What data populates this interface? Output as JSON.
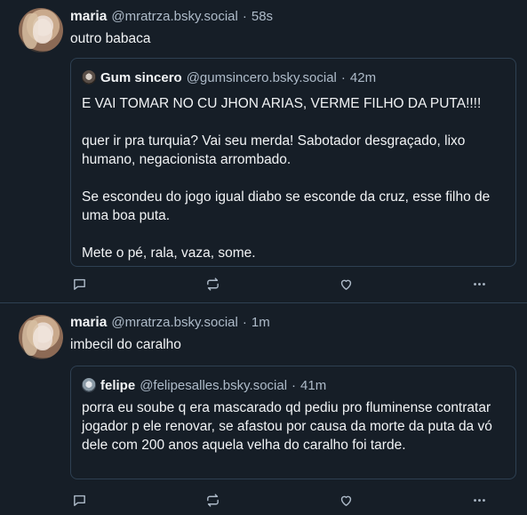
{
  "posts": [
    {
      "author_name": "maria",
      "author_handle": "@mratrza.bsky.social",
      "separator": "·",
      "time": "58s",
      "text": "outro babaca",
      "quote": {
        "author_name": "Gum sincero",
        "author_handle": "@gumsincero.bsky.social",
        "separator": "·",
        "time": "42m",
        "text": "E VAI TOMAR NO CU JHON ARIAS, VERME FILHO DA PUTA!!!!\n\nquer ir pra turquia? Vai seu merda! Sabotador desgraçado, lixo humano, negacionista arrombado.\n\nSe escondeu do jogo igual diabo se esconde da cruz, esse filho de uma boa puta.\n\nMete o pé, rala, vaza, some."
      },
      "actions": [
        "reply-icon",
        "repost-icon",
        "like-icon",
        "more-icon"
      ]
    },
    {
      "author_name": "maria",
      "author_handle": "@mratrza.bsky.social",
      "separator": "·",
      "time": "1m",
      "text": "imbecil do caralho",
      "quote": {
        "author_name": "felipe",
        "author_handle": "@felipesalles.bsky.social",
        "separator": "·",
        "time": "41m",
        "text": "porra eu soube q era mascarado qd pediu pro fluminense contratar jogador p ele renovar, se afastou por causa da morte da puta da vó dele com 200 anos aquela velha do caralho foi tarde."
      },
      "actions": [
        "reply-icon",
        "repost-icon",
        "like-icon",
        "more-icon"
      ]
    }
  ],
  "colors": {
    "background": "#161e27",
    "border": "#2e4052",
    "muted_text": "#aebbc9",
    "text": "#f1f3f5"
  }
}
